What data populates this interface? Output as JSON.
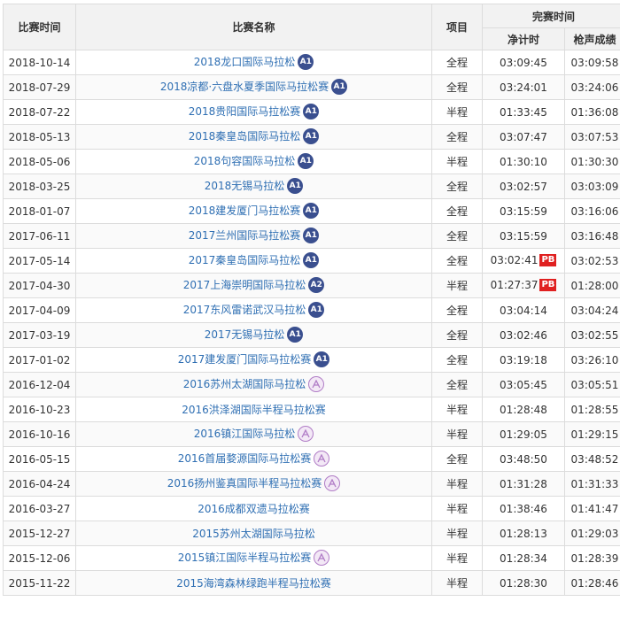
{
  "header": {
    "date": "比赛时间",
    "name": "比赛名称",
    "type": "项目",
    "finish": "完赛时间",
    "net": "净计时",
    "gun": "枪声成绩"
  },
  "colors": {
    "link": "#2f6fb3",
    "badge_dark": "#3a4f8f",
    "badge_purple": "#b07cc6",
    "pb": "#e02020"
  },
  "rows": [
    {
      "date": "2018-10-14",
      "name": "2018龙口国际马拉松",
      "badge": "A1",
      "type": "全程",
      "net": "03:09:45",
      "pb": "",
      "gun": "03:09:58"
    },
    {
      "date": "2018-07-29",
      "name": "2018凉都·六盘水夏季国际马拉松赛",
      "badge": "A1",
      "type": "全程",
      "net": "03:24:01",
      "pb": "",
      "gun": "03:24:06"
    },
    {
      "date": "2018-07-22",
      "name": "2018贵阳国际马拉松赛",
      "badge": "A1",
      "type": "半程",
      "net": "01:33:45",
      "pb": "",
      "gun": "01:36:08"
    },
    {
      "date": "2018-05-13",
      "name": "2018秦皇岛国际马拉松",
      "badge": "A1",
      "type": "全程",
      "net": "03:07:47",
      "pb": "",
      "gun": "03:07:53"
    },
    {
      "date": "2018-05-06",
      "name": "2018句容国际马拉松",
      "badge": "A1",
      "type": "半程",
      "net": "01:30:10",
      "pb": "",
      "gun": "01:30:30"
    },
    {
      "date": "2018-03-25",
      "name": "2018无锡马拉松",
      "badge": "A1",
      "type": "全程",
      "net": "03:02:57",
      "pb": "",
      "gun": "03:03:09"
    },
    {
      "date": "2018-01-07",
      "name": "2018建发厦门马拉松赛",
      "badge": "A1",
      "type": "全程",
      "net": "03:15:59",
      "pb": "",
      "gun": "03:16:06"
    },
    {
      "date": "2017-06-11",
      "name": "2017兰州国际马拉松赛",
      "badge": "A1",
      "type": "全程",
      "net": "03:15:59",
      "pb": "",
      "gun": "03:16:48"
    },
    {
      "date": "2017-05-14",
      "name": "2017秦皇岛国际马拉松",
      "badge": "A1",
      "type": "全程",
      "net": "03:02:41",
      "pb": "PB",
      "gun": "03:02:53"
    },
    {
      "date": "2017-04-30",
      "name": "2017上海崇明国际马拉松",
      "badge": "A2",
      "type": "半程",
      "net": "01:27:37",
      "pb": "PB",
      "gun": "01:28:00"
    },
    {
      "date": "2017-04-09",
      "name": "2017东风雷诺武汉马拉松",
      "badge": "A1",
      "type": "全程",
      "net": "03:04:14",
      "pb": "",
      "gun": "03:04:24"
    },
    {
      "date": "2017-03-19",
      "name": "2017无锡马拉松",
      "badge": "A1",
      "type": "全程",
      "net": "03:02:46",
      "pb": "",
      "gun": "03:02:55"
    },
    {
      "date": "2017-01-02",
      "name": "2017建发厦门国际马拉松赛",
      "badge": "A1",
      "type": "全程",
      "net": "03:19:18",
      "pb": "",
      "gun": "03:26:10"
    },
    {
      "date": "2016-12-04",
      "name": "2016苏州太湖国际马拉松",
      "badge": "A",
      "type": "全程",
      "net": "03:05:45",
      "pb": "",
      "gun": "03:05:51"
    },
    {
      "date": "2016-10-23",
      "name": "2016洪泽湖国际半程马拉松赛",
      "badge": "",
      "type": "半程",
      "net": "01:28:48",
      "pb": "",
      "gun": "01:28:55"
    },
    {
      "date": "2016-10-16",
      "name": "2016镇江国际马拉松",
      "badge": "A",
      "type": "半程",
      "net": "01:29:05",
      "pb": "",
      "gun": "01:29:15"
    },
    {
      "date": "2016-05-15",
      "name": "2016首届婺源国际马拉松赛",
      "badge": "A",
      "type": "全程",
      "net": "03:48:50",
      "pb": "",
      "gun": "03:48:52"
    },
    {
      "date": "2016-04-24",
      "name": "2016扬州鉴真国际半程马拉松赛",
      "badge": "A",
      "type": "半程",
      "net": "01:31:28",
      "pb": "",
      "gun": "01:31:33"
    },
    {
      "date": "2016-03-27",
      "name": "2016成都双遗马拉松赛",
      "badge": "",
      "type": "半程",
      "net": "01:38:46",
      "pb": "",
      "gun": "01:41:47"
    },
    {
      "date": "2015-12-27",
      "name": "2015苏州太湖国际马拉松",
      "badge": "",
      "type": "半程",
      "net": "01:28:13",
      "pb": "",
      "gun": "01:29:03"
    },
    {
      "date": "2015-12-06",
      "name": "2015镇江国际半程马拉松赛",
      "badge": "A",
      "type": "半程",
      "net": "01:28:34",
      "pb": "",
      "gun": "01:28:39"
    },
    {
      "date": "2015-11-22",
      "name": "2015海湾森林绿跑半程马拉松赛",
      "badge": "",
      "type": "半程",
      "net": "01:28:30",
      "pb": "",
      "gun": "01:28:46"
    }
  ]
}
